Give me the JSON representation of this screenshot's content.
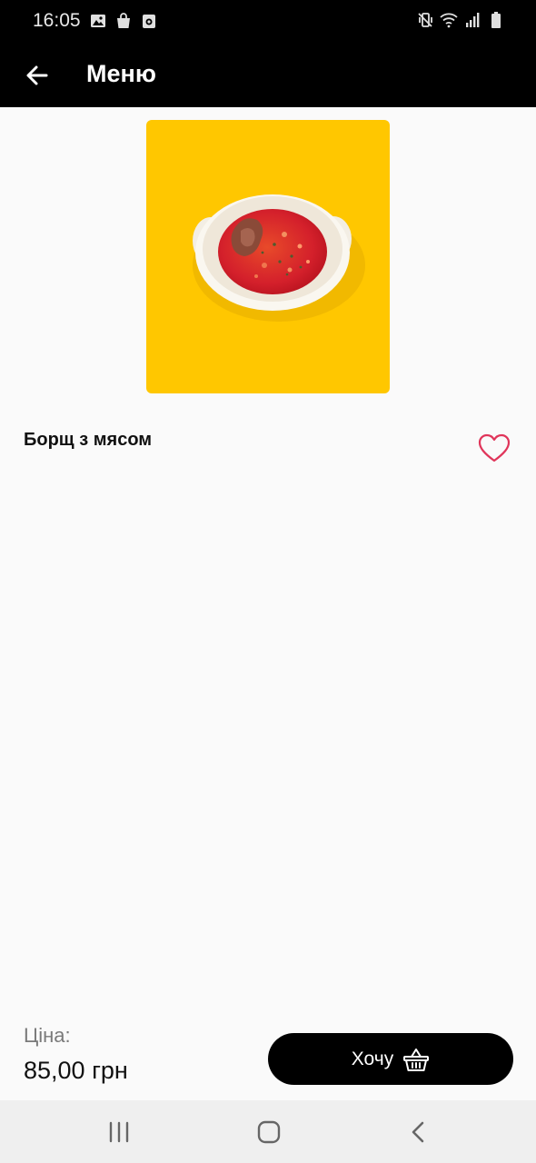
{
  "status_bar": {
    "time": "16:05",
    "left_icons": [
      "image-icon",
      "shopping-bag-icon",
      "camera-icon"
    ],
    "right_icons": [
      "vibrate-icon",
      "wifi-icon",
      "signal-icon",
      "battery-icon"
    ]
  },
  "app_bar": {
    "title": "Меню",
    "back_icon": "arrow-left-icon"
  },
  "product": {
    "name": "Борщ з мясом",
    "image": "borscht-bowl-image",
    "image_background": "#ffc700",
    "favorite_icon": "heart-outline-icon",
    "favorite_color": "#e0355a"
  },
  "price": {
    "label": "Ціна:",
    "value": "85,00 грн"
  },
  "order_button": {
    "label": "Хочу",
    "icon": "basket-icon"
  },
  "nav_bar": {
    "items": [
      "recent-apps-icon",
      "home-icon",
      "back-icon"
    ]
  }
}
